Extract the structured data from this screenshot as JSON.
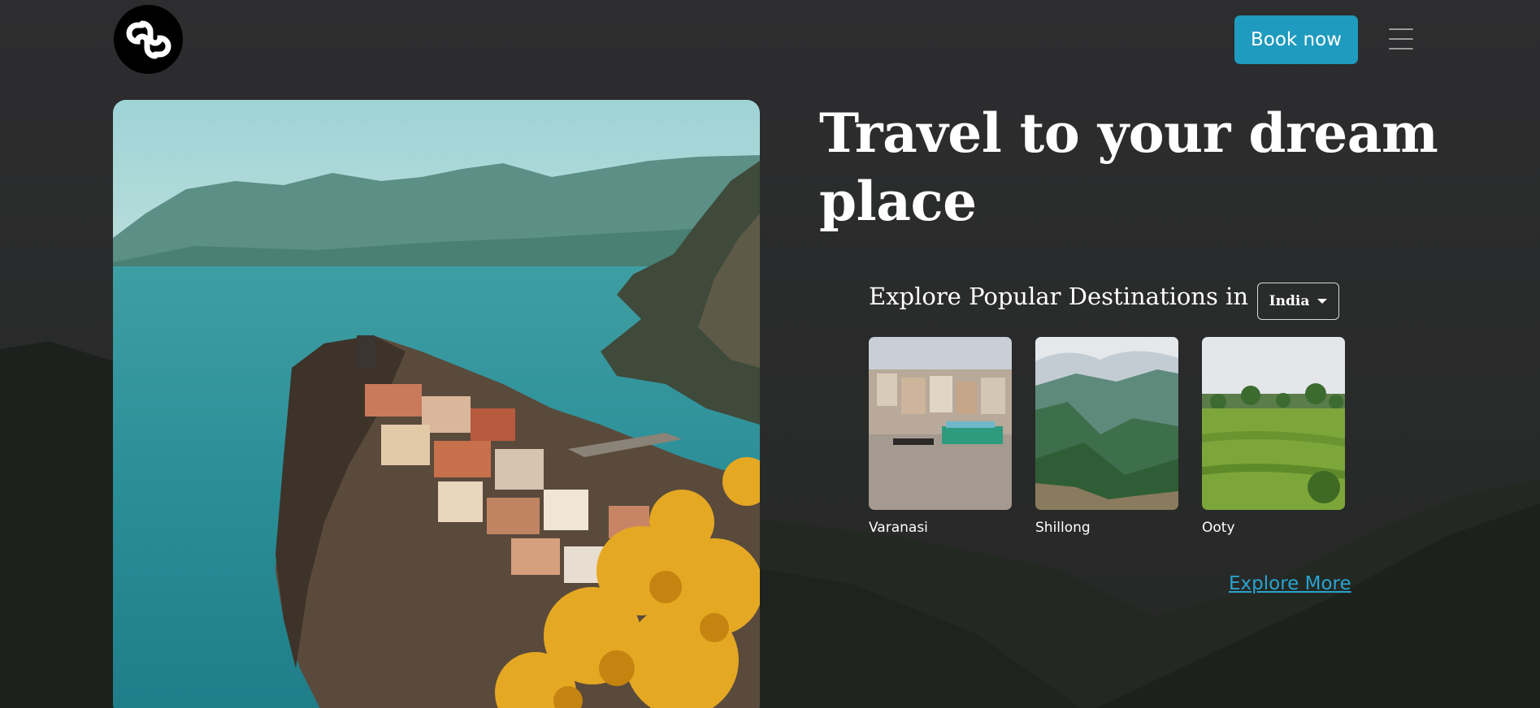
{
  "header": {
    "logo_icon": "swirl-knot-logo",
    "book_button_label": "Book now",
    "menu_icon": "hamburger-menu-icon"
  },
  "hero": {
    "headline": "Travel to your dream place",
    "image": "coastal-cliff-village-photo"
  },
  "explore": {
    "title": "Explore Popular Destinations in",
    "selected_country": "India",
    "destinations": [
      {
        "name": "Varanasi",
        "image": "river-ghats-photo"
      },
      {
        "name": "Shillong",
        "image": "green-valley-photo"
      },
      {
        "name": "Ooty",
        "image": "tea-plantation-photo"
      }
    ],
    "explore_more_label": "Explore More"
  },
  "colors": {
    "accent": "#1f9bbf",
    "link": "#2aa3cf",
    "background": "#2b2b2d"
  }
}
